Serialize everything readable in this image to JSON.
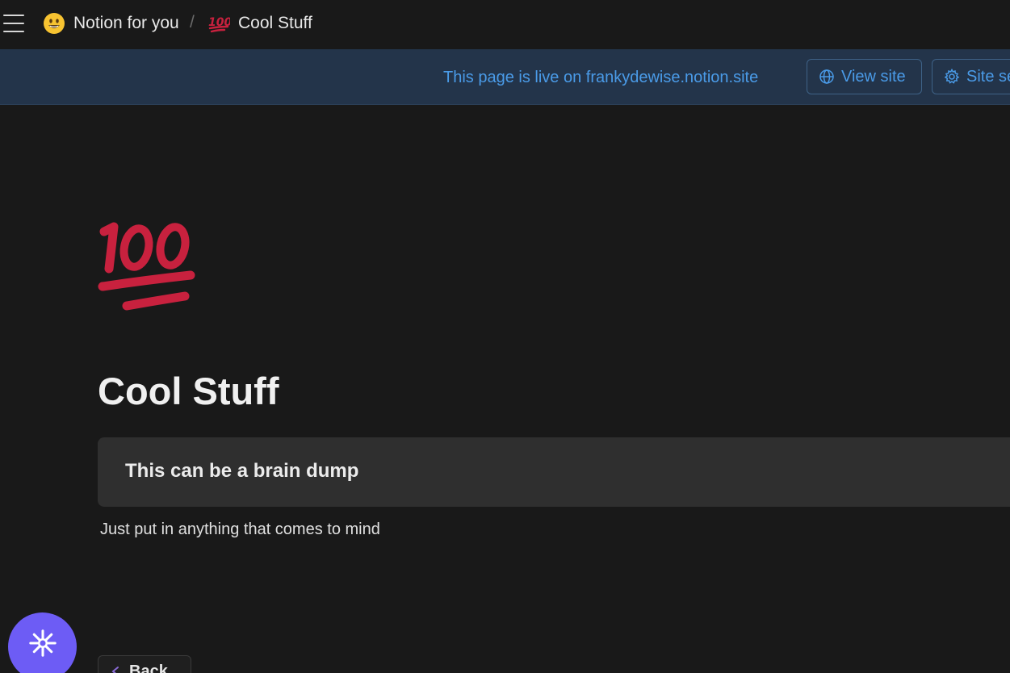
{
  "breadcrumb": {
    "items": [
      {
        "label": "Notion for you",
        "icon": "grinning-face-emoji"
      },
      {
        "label": "Cool Stuff",
        "icon": "hundred-points-emoji"
      }
    ],
    "separator": "/"
  },
  "banner": {
    "text": "This page is live on frankydewise.notion.site",
    "view_site_label": "View site",
    "site_settings_label": "Site se",
    "accent_color": "#4a9be8",
    "background_color": "#23344a"
  },
  "page": {
    "icon": "hundred-points-emoji",
    "title": "Cool Stuff",
    "callout_text": "This can be a brain dump",
    "body_text": "Just put in anything that comes to mind"
  },
  "floating_button": {
    "icon": "sparkle-asterisk-icon",
    "color": "#6d5cf5"
  },
  "back_button": {
    "label": "Back"
  }
}
